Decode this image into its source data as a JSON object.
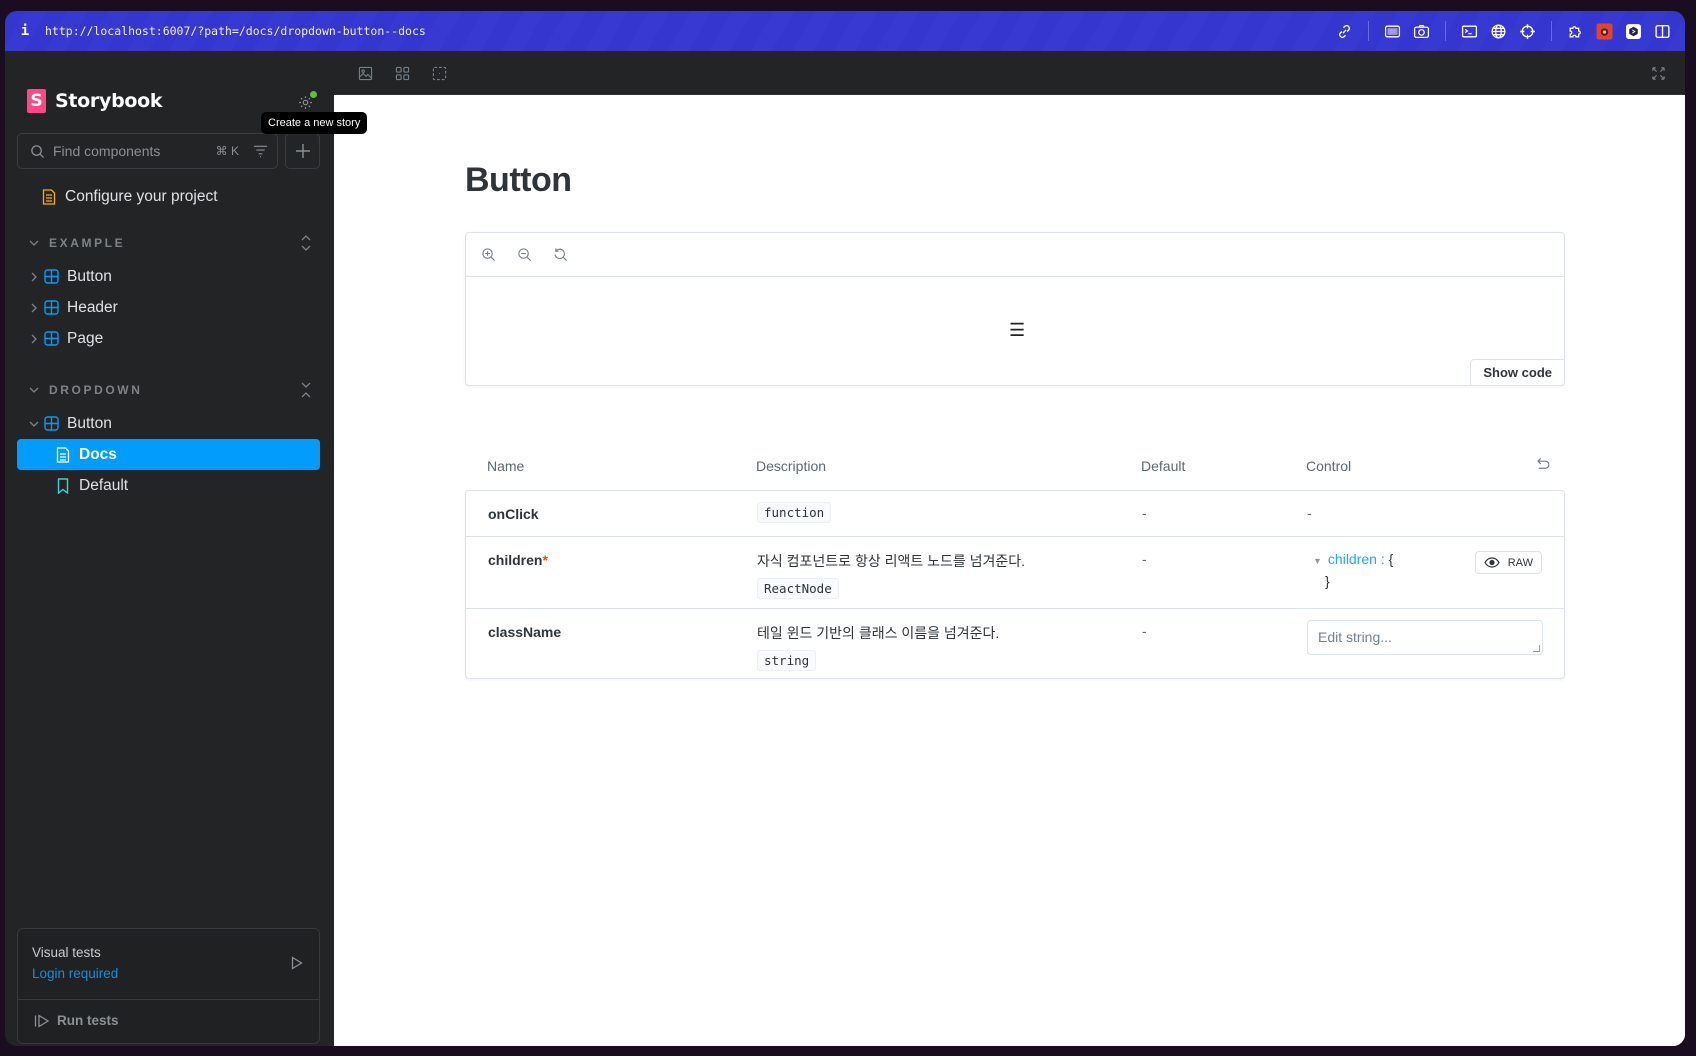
{
  "browser": {
    "info_label": "i",
    "url": "http://localhost:6007/?path=/docs/dropdown-button--docs",
    "tools": [
      {
        "icon": "link-icon"
      },
      {
        "icon": "screen-capture-icon"
      },
      {
        "icon": "camera-icon"
      },
      {
        "icon": "terminal-icon"
      },
      {
        "icon": "globe-icon"
      },
      {
        "icon": "crosshair-icon"
      },
      {
        "icon": "puzzle-icon"
      },
      {
        "icon": "bug-extension-icon"
      },
      {
        "icon": "extension-icon"
      },
      {
        "icon": "split-view-icon"
      }
    ]
  },
  "sidebar": {
    "brand": "Storybook",
    "brand_logo_letter": "S",
    "tooltip": "Create a new story",
    "search": {
      "placeholder": "Find components",
      "shortcut": "⌘ K"
    },
    "config_item": "Configure your project",
    "groups": [
      {
        "label": "EXAMPLE",
        "items": [
          {
            "label": "Button",
            "type": "component",
            "expanded": false
          },
          {
            "label": "Header",
            "type": "component",
            "expanded": false
          },
          {
            "label": "Page",
            "type": "component",
            "expanded": false
          }
        ]
      },
      {
        "label": "DROPDOWN",
        "items": [
          {
            "label": "Button",
            "type": "component",
            "expanded": true
          }
        ],
        "children": [
          {
            "label": "Docs",
            "type": "docs",
            "active": true
          },
          {
            "label": "Default",
            "type": "story",
            "active": false
          }
        ]
      }
    ],
    "visual_tests": {
      "title": "Visual tests",
      "status": "Login required",
      "run_label": "Run tests"
    }
  },
  "colors": {
    "accent": "#029cfd",
    "brand_pink": "#ff4785",
    "url_bar": "#3636d0",
    "required": "#ff4400",
    "link": "#1ea7fd"
  },
  "doc": {
    "title": "Button",
    "preview": {
      "zoom_tools": [
        "zoom-in-icon",
        "zoom-out-icon",
        "zoom-reset-icon"
      ],
      "rendered_content": "☰",
      "show_code": "Show code"
    },
    "argtable": {
      "headers": {
        "name": "Name",
        "description": "Description",
        "default": "Default",
        "control": "Control"
      },
      "rows": [
        {
          "name": "onClick",
          "required": false,
          "description": "",
          "type": "function",
          "default": "-",
          "control": "-"
        },
        {
          "name": "children",
          "required": true,
          "required_mark": "*",
          "description": "자식 컴포넌트로 항상 리액트 노드를 넘겨준다.",
          "type": "ReactNode",
          "default": "-",
          "control": {
            "key": "children",
            "separator": " : ",
            "open": "{",
            "close": "}",
            "raw_label": "RAW"
          }
        },
        {
          "name": "className",
          "required": false,
          "description": "테일 윈드 기반의 클래스 이름을 넘겨준다.",
          "type": "string",
          "default": "-",
          "control": {
            "placeholder": "Edit string..."
          }
        }
      ]
    }
  }
}
